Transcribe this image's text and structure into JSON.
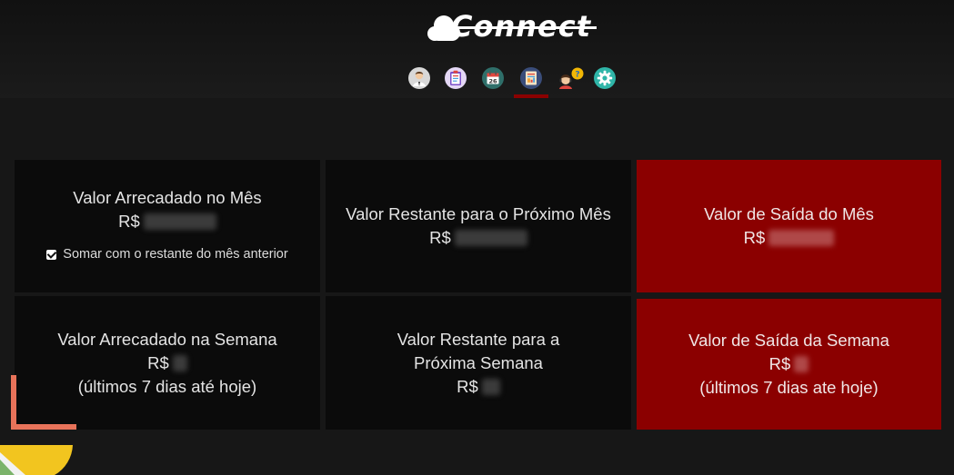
{
  "app": {
    "logo_text": "Connect"
  },
  "nav": {
    "items": [
      {
        "name": "profile-icon",
        "active": false
      },
      {
        "name": "clipboard-icon",
        "active": false
      },
      {
        "name": "calendar-icon",
        "active": false
      },
      {
        "name": "finance-report-icon",
        "active": true
      },
      {
        "name": "support-icon",
        "active": false
      },
      {
        "name": "settings-icon",
        "active": false
      }
    ],
    "calendar_day": "26",
    "help_mark": "?"
  },
  "cards": {
    "month_collected": {
      "title": "Valor Arrecadado no Mês",
      "currency": "R$",
      "checkbox_label": "Somar com o restante do mês anterior",
      "checkbox_checked": true
    },
    "month_remaining": {
      "title": "Valor Restante para o Próximo Mês",
      "currency": "R$"
    },
    "month_out": {
      "title": "Valor de Saída do Mês",
      "currency": "R$"
    },
    "week_collected": {
      "title": "Valor Arrecadado na Semana",
      "currency": "R$",
      "note": "(últimos 7 dias até hoje)"
    },
    "week_remaining": {
      "title_line1": "Valor Restante para a",
      "title_line2": "Próxima Semana",
      "currency": "R$"
    },
    "week_out": {
      "title": "Valor de Saída da Semana",
      "currency": "R$",
      "note": "(últimos 7 dias ate hoje)"
    }
  },
  "colors": {
    "background": "#171717",
    "card": "#0b0b0b",
    "accent_red": "#8b0000"
  }
}
